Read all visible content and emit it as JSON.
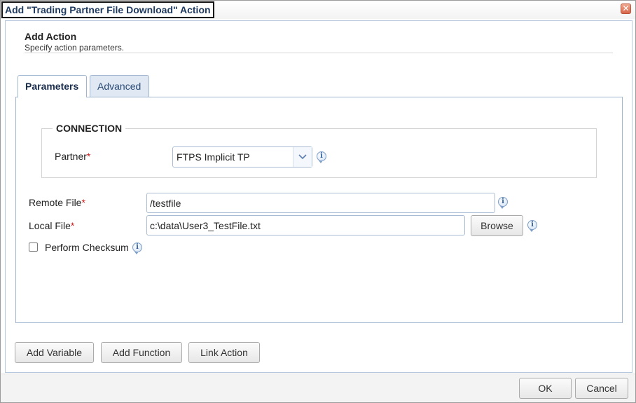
{
  "dialog": {
    "title": "Add \"Trading Partner File Download\" Action",
    "close_glyph": "✕"
  },
  "header": {
    "title": "Add Action",
    "subtitle": "Specify action parameters."
  },
  "tabs": [
    {
      "label": "Parameters",
      "active": true
    },
    {
      "label": "Advanced",
      "active": false
    }
  ],
  "connection": {
    "legend": "CONNECTION",
    "partner_label": "Partner",
    "partner_value": "FTPS Implicit TP"
  },
  "fields": {
    "required_marker": "*",
    "remote_file_label": "Remote File",
    "remote_file_value": "/testfile",
    "local_file_label": "Local File",
    "local_file_value": "c:\\data\\User3_TestFile.txt",
    "browse_label": "Browse",
    "checksum_label": "Perform Checksum",
    "checksum_checked": false
  },
  "actions": {
    "add_variable": "Add Variable",
    "add_function": "Add Function",
    "link_action": "Link Action"
  },
  "footer": {
    "ok": "OK",
    "cancel": "Cancel"
  },
  "icons": {
    "info": "info-icon",
    "close": "close-icon",
    "dropdown": "chevron-down-icon"
  },
  "colors": {
    "title_text": "#1f3a60",
    "required": "#d01818",
    "tab_border": "#9fb5d0",
    "close_button": "#d8674a"
  }
}
